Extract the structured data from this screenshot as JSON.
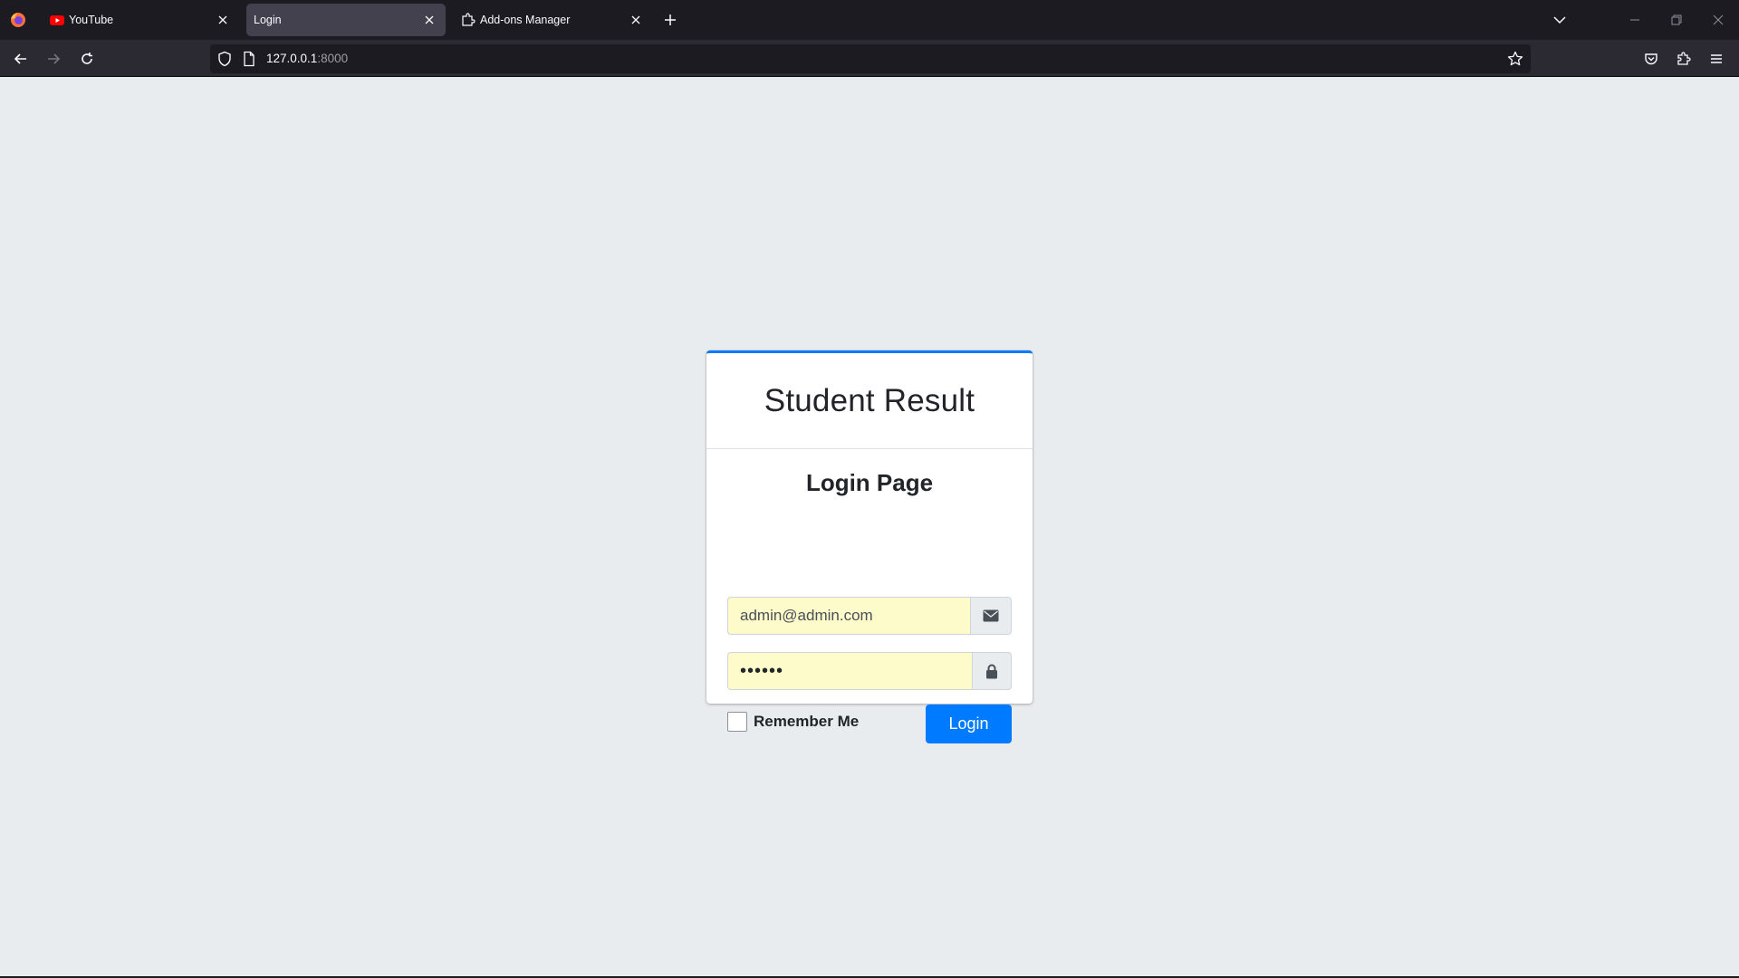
{
  "browser": {
    "tabs": [
      {
        "title": "YouTube",
        "icon": "youtube-icon",
        "active": false
      },
      {
        "title": "Login",
        "icon": "",
        "active": true
      },
      {
        "title": "Add-ons Manager",
        "icon": "puzzle-icon",
        "active": false
      }
    ],
    "url": {
      "host": "127.0.0.1",
      "port": ":8000"
    }
  },
  "page": {
    "brand": "Student Result",
    "login_title": "Login Page",
    "email_value": "admin@admin.com",
    "password_value": "••••••",
    "remember_label": "Remember Me",
    "login_button": "Login"
  },
  "colors": {
    "accent": "#007bff",
    "page_bg": "#e9ecef",
    "autofill_bg": "#fdfbc9",
    "chrome_bg": "#1c1b22"
  }
}
